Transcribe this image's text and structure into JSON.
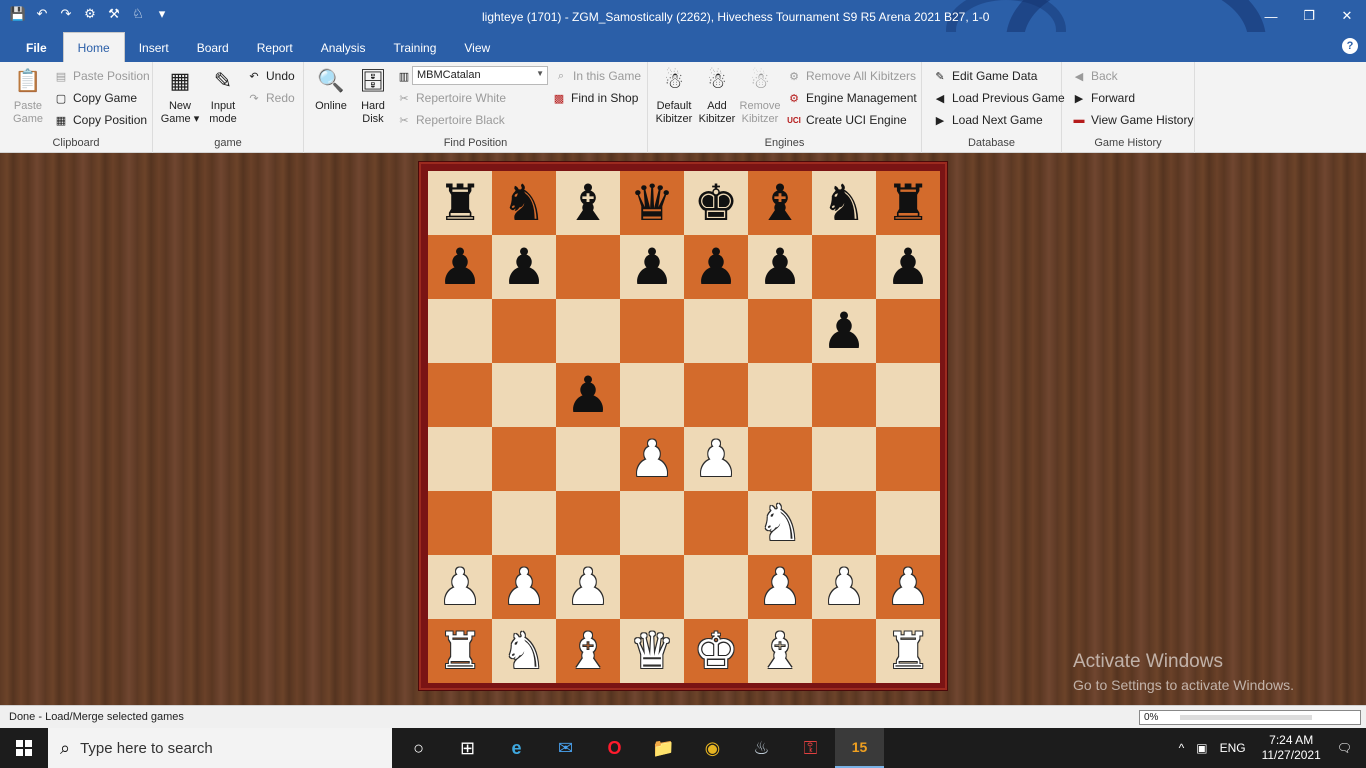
{
  "window": {
    "title": "lighteye (1701) - ZGM_Samostically (2262), Hivechess Tournament S9 R5 Arena 2021  B27, 1-0",
    "controls": [
      "—",
      "❐",
      "✕"
    ]
  },
  "qat": [
    "💾",
    "↶",
    "↷",
    "⚙",
    "⚒",
    "♘",
    "▾"
  ],
  "tabs": [
    "File",
    "Home",
    "Insert",
    "Board",
    "Report",
    "Analysis",
    "Training",
    "View"
  ],
  "ribbon": {
    "clipboard": {
      "label": "Clipboard",
      "paste_game": [
        "Paste",
        "Game"
      ],
      "paste_position": "Paste Position",
      "copy_game": "Copy Game",
      "copy_position": "Copy Position"
    },
    "game": {
      "label": "game",
      "new_game": [
        "New",
        "Game ▾"
      ],
      "input_mode": [
        "Input",
        "mode"
      ],
      "undo": "Undo",
      "redo": "Redo"
    },
    "find_position": {
      "label": "Find Position",
      "online": "Online",
      "hard_disk": [
        "Hard",
        "Disk"
      ],
      "combo_value": "MBMCatalan",
      "in_this_game": "In this Game",
      "find_in_shop": "Find in Shop",
      "repertoire_white": "Repertoire White",
      "repertoire_black": "Repertoire Black"
    },
    "engines": {
      "label": "Engines",
      "default_kibitzer": [
        "Default",
        "Kibitzer"
      ],
      "add_kibitzer": [
        "Add",
        "Kibitzer"
      ],
      "remove_kibitzer": [
        "Remove",
        "Kibitzer"
      ],
      "remove_all_kibitzers": "Remove All Kibitzers",
      "engine_management": "Engine Management",
      "create_uci_engine": "Create UCI Engine"
    },
    "database": {
      "label": "Database",
      "edit_game_data": "Edit Game Data",
      "load_previous_game": "Load Previous Game",
      "load_next_game": "Load Next Game"
    },
    "game_history": {
      "label": "Game History",
      "back": "Back",
      "forward": "Forward",
      "view_game_history": "View Game History"
    }
  },
  "board": {
    "rows": [
      [
        "br",
        "bn",
        "bb",
        "bq",
        "bk",
        "bb",
        "bn",
        "br"
      ],
      [
        "bp",
        "bp",
        "",
        "bp",
        "bp",
        "bp",
        "",
        "bp"
      ],
      [
        "",
        "",
        "",
        "",
        "",
        "",
        "bp",
        ""
      ],
      [
        "",
        "",
        "bp",
        "",
        "",
        "",
        "",
        ""
      ],
      [
        "",
        "",
        "",
        "wp",
        "wp",
        "",
        "",
        ""
      ],
      [
        "",
        "",
        "",
        "",
        "",
        "wn",
        "",
        ""
      ],
      [
        "wp",
        "wp",
        "wp",
        "",
        "",
        "wp",
        "wp",
        "wp"
      ],
      [
        "wr",
        "wn",
        "wb",
        "wq",
        "wk",
        "wb",
        "",
        "wr"
      ]
    ],
    "glyphs": {
      "k": "♚",
      "q": "♛",
      "r": "♜",
      "b": "♝",
      "n": "♞",
      "p": "♟"
    },
    "light_color": "#eed9b6",
    "dark_color": "#d36b2c"
  },
  "watermark": {
    "line1": "Activate Windows",
    "line2": "Go to Settings to activate Windows."
  },
  "status": {
    "text": "Done - Load/Merge selected games",
    "progress_label": "0%",
    "progress_value": 0
  },
  "taskbar": {
    "search_placeholder": "Type here to search",
    "apps": [
      "○",
      "⊞",
      "e",
      "✉",
      "O",
      "📁",
      "◉",
      "♨",
      "⚿",
      "15"
    ],
    "tray_lang": "ENG",
    "tray_up": "^",
    "time": "7:24 AM",
    "date": "11/27/2021",
    "notif": "🗨"
  }
}
